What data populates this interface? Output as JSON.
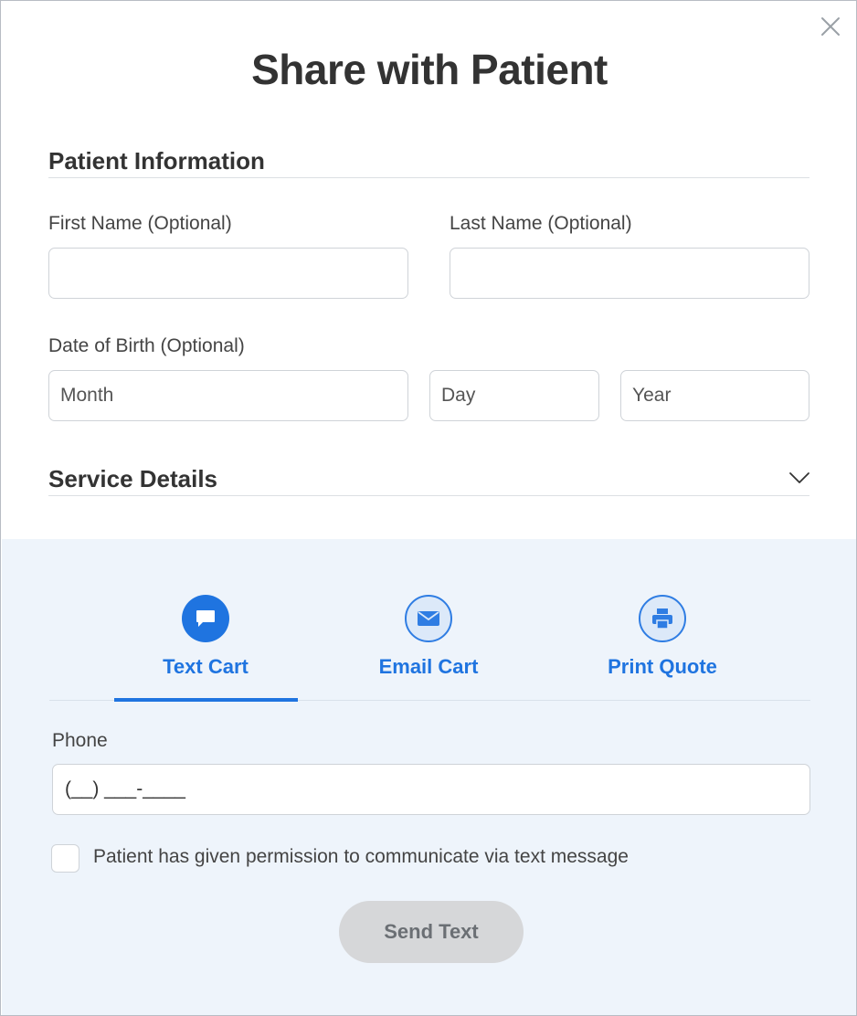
{
  "modal": {
    "title": "Share with Patient"
  },
  "patient_info": {
    "heading": "Patient Information",
    "first_name": {
      "label": "First Name (Optional)",
      "value": "",
      "placeholder": ""
    },
    "last_name": {
      "label": "Last Name (Optional)",
      "value": "",
      "placeholder": ""
    },
    "dob": {
      "label": "Date of Birth (Optional)",
      "month_placeholder": "Month",
      "day_placeholder": "Day",
      "year_placeholder": "Year"
    }
  },
  "service_details": {
    "heading": "Service Details",
    "icon": "chevron-down-icon"
  },
  "share_tabs": {
    "active": "Text Cart",
    "items": [
      {
        "label": "Text Cart",
        "icon": "chat-bubble-icon"
      },
      {
        "label": "Email Cart",
        "icon": "envelope-icon"
      },
      {
        "label": "Print Quote",
        "icon": "printer-icon"
      }
    ]
  },
  "text_form": {
    "phone_label": "Phone",
    "phone_placeholder": "(__) ___-____",
    "permission_label": "Patient has given permission to communicate via text message",
    "permission_checked": false,
    "send_label": "Send Text"
  },
  "colors": {
    "accent": "#1f74e0",
    "panel_bg": "#eef4fb",
    "disabled_button": "#d6d7d9"
  }
}
